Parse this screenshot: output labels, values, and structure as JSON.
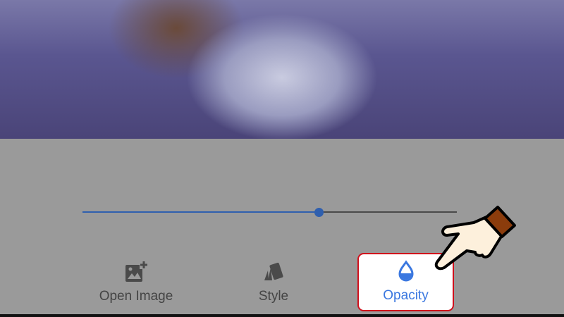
{
  "toolbar": {
    "items": [
      {
        "label": "Open Image",
        "icon": "add-image-icon"
      },
      {
        "label": "Style",
        "icon": "style-cards-icon"
      },
      {
        "label": "Opacity",
        "icon": "opacity-drop-icon",
        "selected": true
      }
    ]
  },
  "slider": {
    "value": 0.63
  },
  "colors": {
    "accent": "#3b78e0",
    "slider": "#2f5fae",
    "highlight": "#d0101c"
  }
}
